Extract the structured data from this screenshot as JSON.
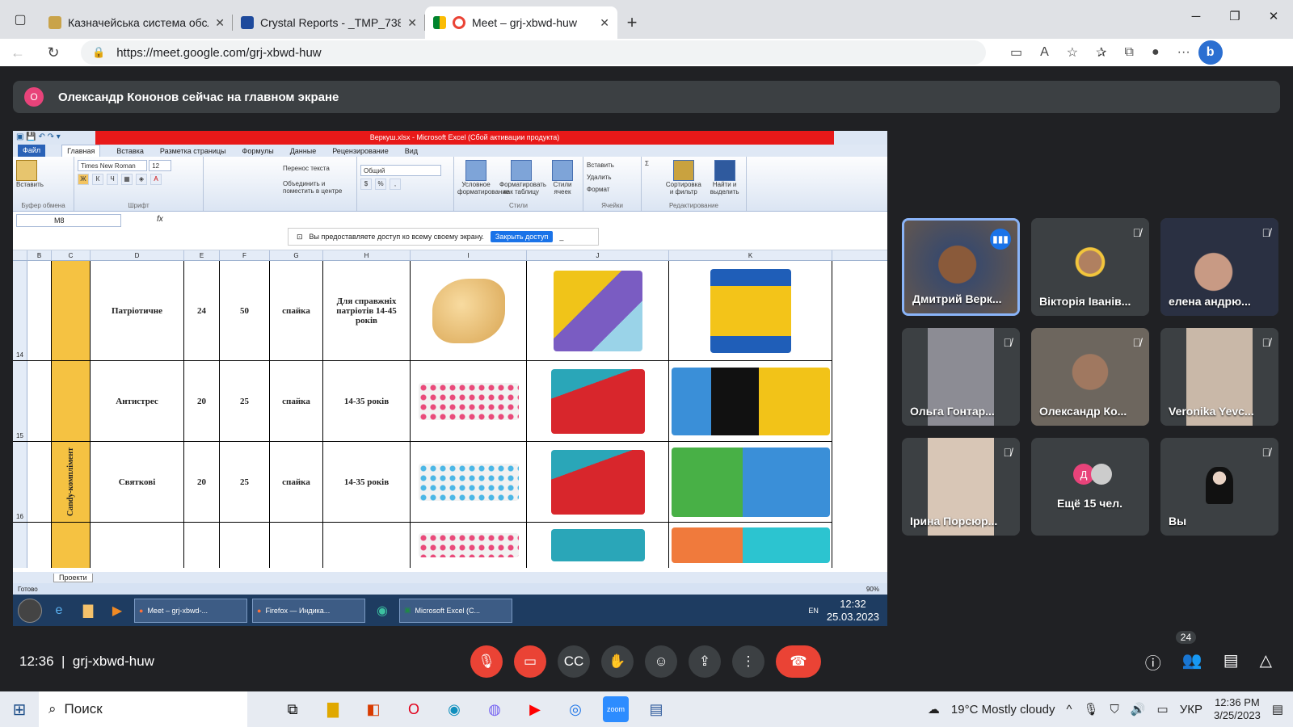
{
  "browser": {
    "tabs": [
      {
        "title": "Казначейська система обслугов",
        "active": false
      },
      {
        "title": "Crystal Reports - _TMP_7384634",
        "active": false
      },
      {
        "title": "Meet – grj-xbwd-huw",
        "active": true
      }
    ],
    "url": "https://meet.google.com/grj-xbwd-huw"
  },
  "meet": {
    "presenter_banner": "Олександр Кононов сейчас на главном экране",
    "presenter_initial": "О",
    "clock": "12:36",
    "meeting_code": "grj-xbwd-huw",
    "participants_count": "24",
    "participants": [
      {
        "name": "Дмитрий Верк...",
        "muted": false,
        "speaking": true
      },
      {
        "name": "Вікторія Іванів...",
        "muted": true
      },
      {
        "name": "елена андрю...",
        "muted": true
      },
      {
        "name": "Ольга Гонтар...",
        "muted": true
      },
      {
        "name": "Олександр Ко...",
        "muted": true
      },
      {
        "name": "Veronika Yevc...",
        "muted": true
      },
      {
        "name": "Ірина Порсюр...",
        "muted": true
      },
      {
        "name": "Ещё 15 чел.",
        "initial": "Д"
      },
      {
        "name": "Вы",
        "muted": true
      }
    ]
  },
  "excel": {
    "title": "Веркуш.xlsx - Microsoft Excel (Сбой активации продукта)",
    "menu": [
      "Файл",
      "Главная",
      "Вставка",
      "Разметка страницы",
      "Формулы",
      "Данные",
      "Рецензирование",
      "Вид"
    ],
    "font_name": "Times New Roman",
    "font_size": "12",
    "wrap_text": "Перенос текста",
    "merge": "Объединить и поместить в центре",
    "number_format": "Общий",
    "groups": [
      "Буфер обмена",
      "Шрифт",
      "Стили",
      "Ячейки",
      "Редактирование"
    ],
    "paste": "Вставить",
    "cond_format": "Условное форматирование",
    "format_table": "Форматировать как таблицу",
    "cell_styles": "Стили ячеек",
    "insert": "Вставить",
    "delete": "Удалить",
    "format": "Формат",
    "sort": "Сортировка и фильтр",
    "find": "Найти и выделить",
    "share_notice": "Вы предоставляете доступ ко всему своему экрану.",
    "stop_sharing": "Закрыть доступ",
    "name_box": "M8",
    "columns": [
      "B",
      "C",
      "D",
      "E",
      "F",
      "G",
      "H",
      "I",
      "J",
      "K"
    ],
    "rows": [
      {
        "num": "14",
        "d": "Патріотичне",
        "e": "24",
        "f": "50",
        "g": "спайка",
        "h": "Для справжніх патріотів 14-45 років"
      },
      {
        "num": "15",
        "d": "Антистрес",
        "e": "20",
        "f": "25",
        "g": "спайка",
        "h": "14-35 років"
      },
      {
        "num": "16",
        "d": "Святкові",
        "e": "20",
        "f": "25",
        "g": "спайка",
        "h": "14-35 років"
      }
    ],
    "category": "Candy-комплімент",
    "sheet_tab": "Проекти",
    "status": "Готово",
    "zoom": "90%",
    "taskbar_items": [
      "Meet – grj-xbwd-...",
      "Firefox — Индика...",
      "Microsoft Excel (C..."
    ],
    "lang": "EN",
    "time": "12:32",
    "date": "25.03.2023"
  },
  "windows": {
    "search": "Поиск",
    "weather": "19°C  Mostly cloudy",
    "lang": "УКР",
    "time": "12:36 PM",
    "date": "3/25/2023"
  },
  "colors": {
    "accent": "#1a73e8",
    "end_call": "#ea4335",
    "bg": "#202124"
  }
}
